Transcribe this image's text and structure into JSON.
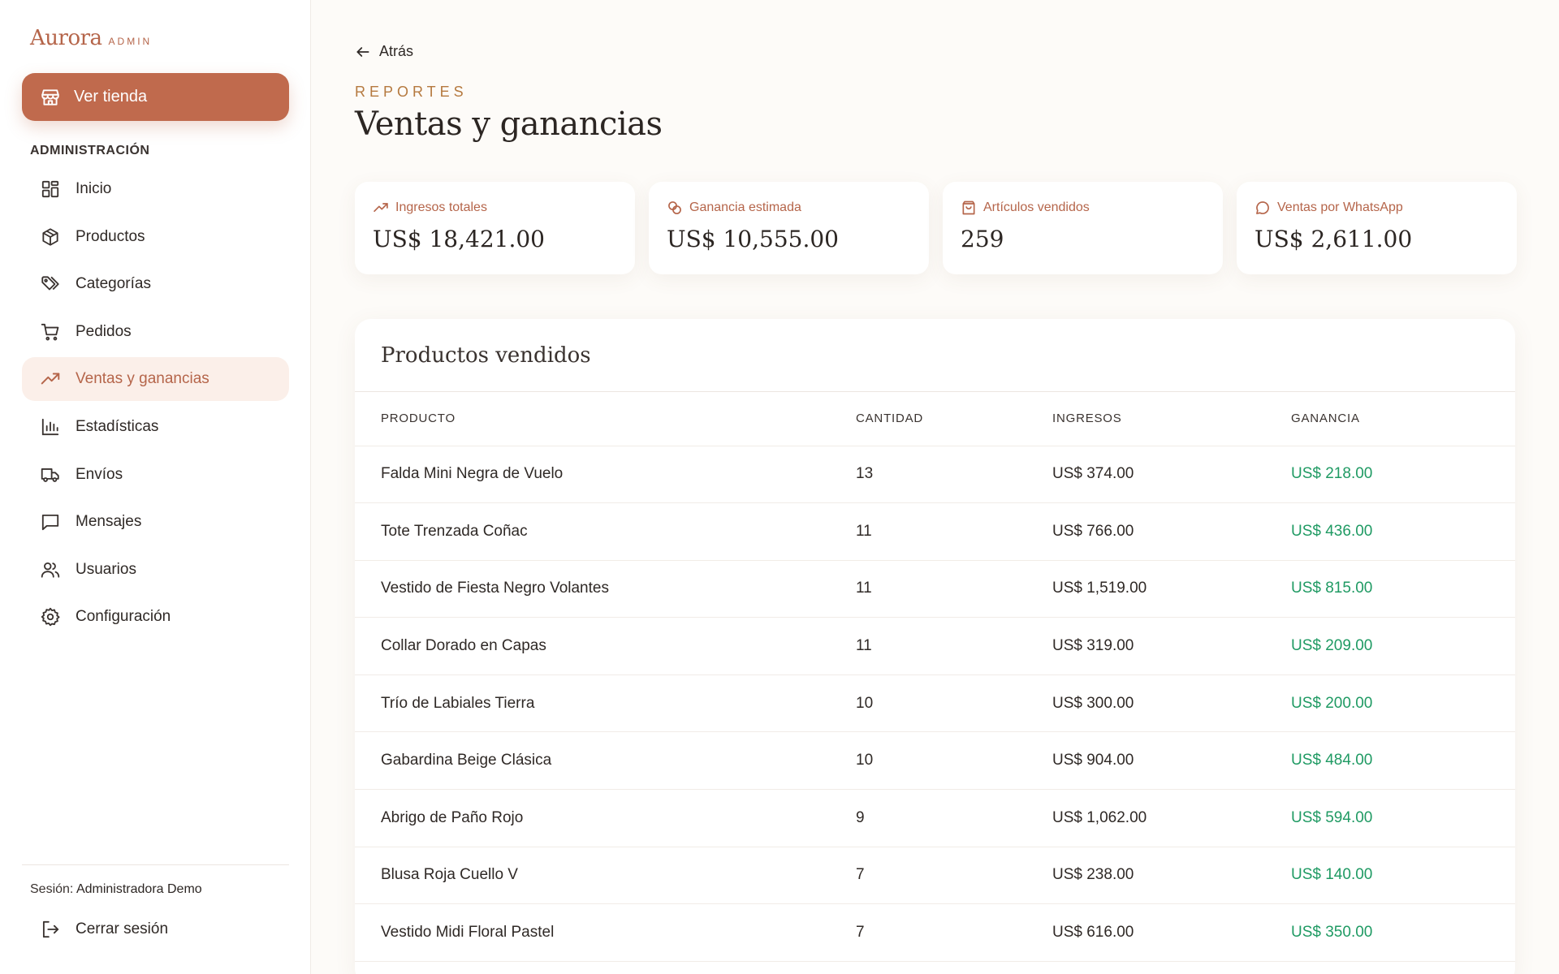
{
  "sidebar": {
    "brand": "Aurora",
    "brand_sub": "ADMIN",
    "store_button": "Ver tienda",
    "section_label": "ADMINISTRACIÓN",
    "items": [
      {
        "label": "Inicio",
        "icon": "grid-icon"
      },
      {
        "label": "Productos",
        "icon": "box-icon"
      },
      {
        "label": "Categorías",
        "icon": "tags-icon"
      },
      {
        "label": "Pedidos",
        "icon": "cart-icon"
      },
      {
        "label": "Ventas y ganancias",
        "icon": "trending-up-icon",
        "active": true
      },
      {
        "label": "Estadísticas",
        "icon": "bar-chart-icon"
      },
      {
        "label": "Envíos",
        "icon": "truck-icon"
      },
      {
        "label": "Mensajes",
        "icon": "message-icon"
      },
      {
        "label": "Usuarios",
        "icon": "users-icon"
      },
      {
        "label": "Configuración",
        "icon": "gear-icon"
      }
    ],
    "session_prefix": "Sesión:",
    "session_user": "Administradora Demo",
    "logout": "Cerrar sesión"
  },
  "header": {
    "back": "Atrás",
    "eyebrow": "REPORTES",
    "title": "Ventas y ganancias"
  },
  "stats": [
    {
      "label": "Ingresos totales",
      "value": "US$ 18,421.00",
      "icon": "trending-up-icon"
    },
    {
      "label": "Ganancia estimada",
      "value": "US$ 10,555.00",
      "icon": "coins-icon"
    },
    {
      "label": "Artículos vendidos",
      "value": "259",
      "icon": "bag-icon"
    },
    {
      "label": "Ventas por WhatsApp",
      "value": "US$ 2,611.00",
      "icon": "chat-bubble-icon"
    }
  ],
  "table": {
    "title": "Productos vendidos",
    "columns": [
      "PRODUCTO",
      "CANTIDAD",
      "INGRESOS",
      "GANANCIA"
    ],
    "rows": [
      [
        "Falda Mini Negra de Vuelo",
        "13",
        "US$ 374.00",
        "US$ 218.00"
      ],
      [
        "Tote Trenzada Coñac",
        "11",
        "US$ 766.00",
        "US$ 436.00"
      ],
      [
        "Vestido de Fiesta Negro Volantes",
        "11",
        "US$ 1,519.00",
        "US$ 815.00"
      ],
      [
        "Collar Dorado en Capas",
        "11",
        "US$ 319.00",
        "US$ 209.00"
      ],
      [
        "Trío de Labiales Tierra",
        "10",
        "US$ 300.00",
        "US$ 200.00"
      ],
      [
        "Gabardina Beige Clásica",
        "10",
        "US$ 904.00",
        "US$ 484.00"
      ],
      [
        "Abrigo de Paño Rojo",
        "9",
        "US$ 1,062.00",
        "US$ 594.00"
      ],
      [
        "Blusa Roja Cuello V",
        "7",
        "US$ 238.00",
        "US$ 140.00"
      ],
      [
        "Vestido Midi Floral Pastel",
        "7",
        "US$ 616.00",
        "US$ 350.00"
      ]
    ]
  },
  "colors": {
    "accent": "#c06a4d",
    "accent_text": "#b5654a",
    "eyebrow": "#b5793f",
    "profit": "#1f9a63",
    "active_bg": "#fbefe9"
  }
}
